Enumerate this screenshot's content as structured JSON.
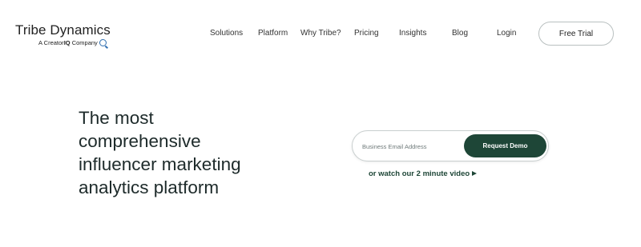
{
  "brand": {
    "title": "Tribe Dynamics",
    "subtitle_prefix": "A Creator",
    "subtitle_bold": "IQ",
    "subtitle_suffix": " Company",
    "icon": "q-logo-icon",
    "accent_color": "#2f6fb0"
  },
  "nav": {
    "items": [
      {
        "label": "Solutions"
      },
      {
        "label": "Platform"
      },
      {
        "label": "Why Tribe?"
      },
      {
        "label": "Pricing"
      },
      {
        "label": "Insights"
      },
      {
        "label": "Blog"
      },
      {
        "label": "Login"
      }
    ],
    "cta_label": "Free Trial"
  },
  "hero": {
    "title_lines": [
      "The most",
      "comprehensive",
      "influencer marketing",
      "analytics platform"
    ]
  },
  "form": {
    "email_placeholder": "Business Email Address",
    "email_value": "",
    "submit_label": "Request Demo",
    "button_color": "#1e4637"
  },
  "video_link": {
    "label": "or watch our 2 minute video",
    "icon": "play-icon"
  }
}
